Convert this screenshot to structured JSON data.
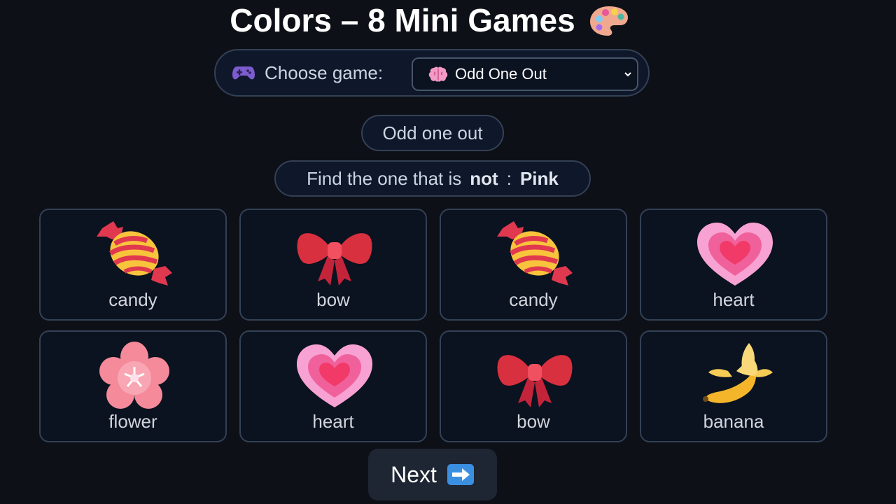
{
  "header": {
    "title": "Colors – 8 Mini Games",
    "title_icon": "palette-icon"
  },
  "chooser": {
    "icon": "gamepad-icon",
    "label": "Choose game:",
    "selected_icon": "brain-icon",
    "selected": "Odd One Out"
  },
  "mode": {
    "label": "Odd one out"
  },
  "prompt": {
    "prefix": "Find the one that is",
    "keyword": "not",
    "separator": ":",
    "color": "Pink"
  },
  "cards": [
    {
      "label": "candy",
      "icon": "candy-icon"
    },
    {
      "label": "bow",
      "icon": "bow-icon"
    },
    {
      "label": "candy",
      "icon": "candy-icon"
    },
    {
      "label": "heart",
      "icon": "heart-icon"
    },
    {
      "label": "flower",
      "icon": "flower-icon"
    },
    {
      "label": "heart",
      "icon": "heart-icon"
    },
    {
      "label": "bow",
      "icon": "bow-icon"
    },
    {
      "label": "banana",
      "icon": "banana-icon"
    }
  ],
  "next": {
    "label": "Next",
    "icon": "right-arrow-icon"
  }
}
